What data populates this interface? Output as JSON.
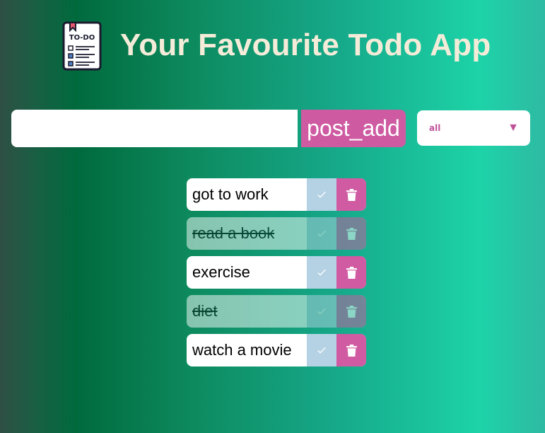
{
  "header": {
    "title": "Your Favourite Todo App",
    "logo_text": "TO-DO",
    "logo_icon": "todo-clipboard-icon"
  },
  "input": {
    "value": "",
    "placeholder": ""
  },
  "add_button": {
    "label": "post_add"
  },
  "filter": {
    "selected": "all",
    "arrow": "▼"
  },
  "todos": [
    {
      "text": "got to work",
      "completed": false
    },
    {
      "text": "read a book",
      "completed": true
    },
    {
      "text": "exercise",
      "completed": false
    },
    {
      "text": "diet",
      "completed": true
    },
    {
      "text": "watch a movie",
      "completed": false
    }
  ],
  "icons": {
    "complete": "check-icon",
    "delete": "trash-icon"
  },
  "colors": {
    "accent": "#ce5ba1",
    "complete_button": "#b5d2e4",
    "title_text": "#f4ecd8"
  }
}
